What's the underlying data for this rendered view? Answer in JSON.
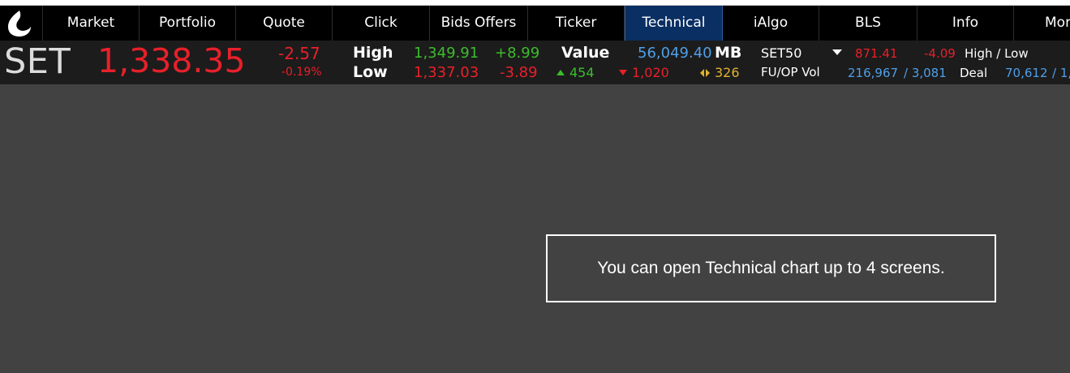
{
  "nav": {
    "items": [
      "Market",
      "Portfolio",
      "Quote",
      "Click",
      "Bids Offers",
      "Ticker",
      "Technical",
      "iAlgo",
      "BLS",
      "Info",
      "More"
    ],
    "active": "Technical"
  },
  "index": {
    "name": "SET",
    "value": "1,338.35",
    "change": "-2.57",
    "change_pct": "-0.19%"
  },
  "high_low": {
    "high_label": "High",
    "high_value": "1,349.91",
    "high_change": "+8.99",
    "low_label": "Low",
    "low_value": "1,337.03",
    "low_change": "-3.89"
  },
  "value": {
    "label": "Value",
    "amount": "56,049.40",
    "unit": "MB",
    "up": "454",
    "down": "1,020",
    "unchanged": "326"
  },
  "set50": {
    "label": "SET50",
    "value": "871.41",
    "change": "-4.09",
    "high_low_label": "High / Low",
    "fuop_label": "FU/OP Vol",
    "fu_vol": "216,967",
    "op_vol": "/ 3,081",
    "deal_label": "Deal",
    "deal_value": "70,612",
    "deal_extra": "/ 1,"
  },
  "message": "You can open Technical chart up to 4 screens.",
  "colors": {
    "up": "#3cbc2c",
    "down": "#e8202a",
    "info": "#4f9fe8",
    "unchanged": "#e0b22e",
    "active_tab": "#0a2f63"
  }
}
